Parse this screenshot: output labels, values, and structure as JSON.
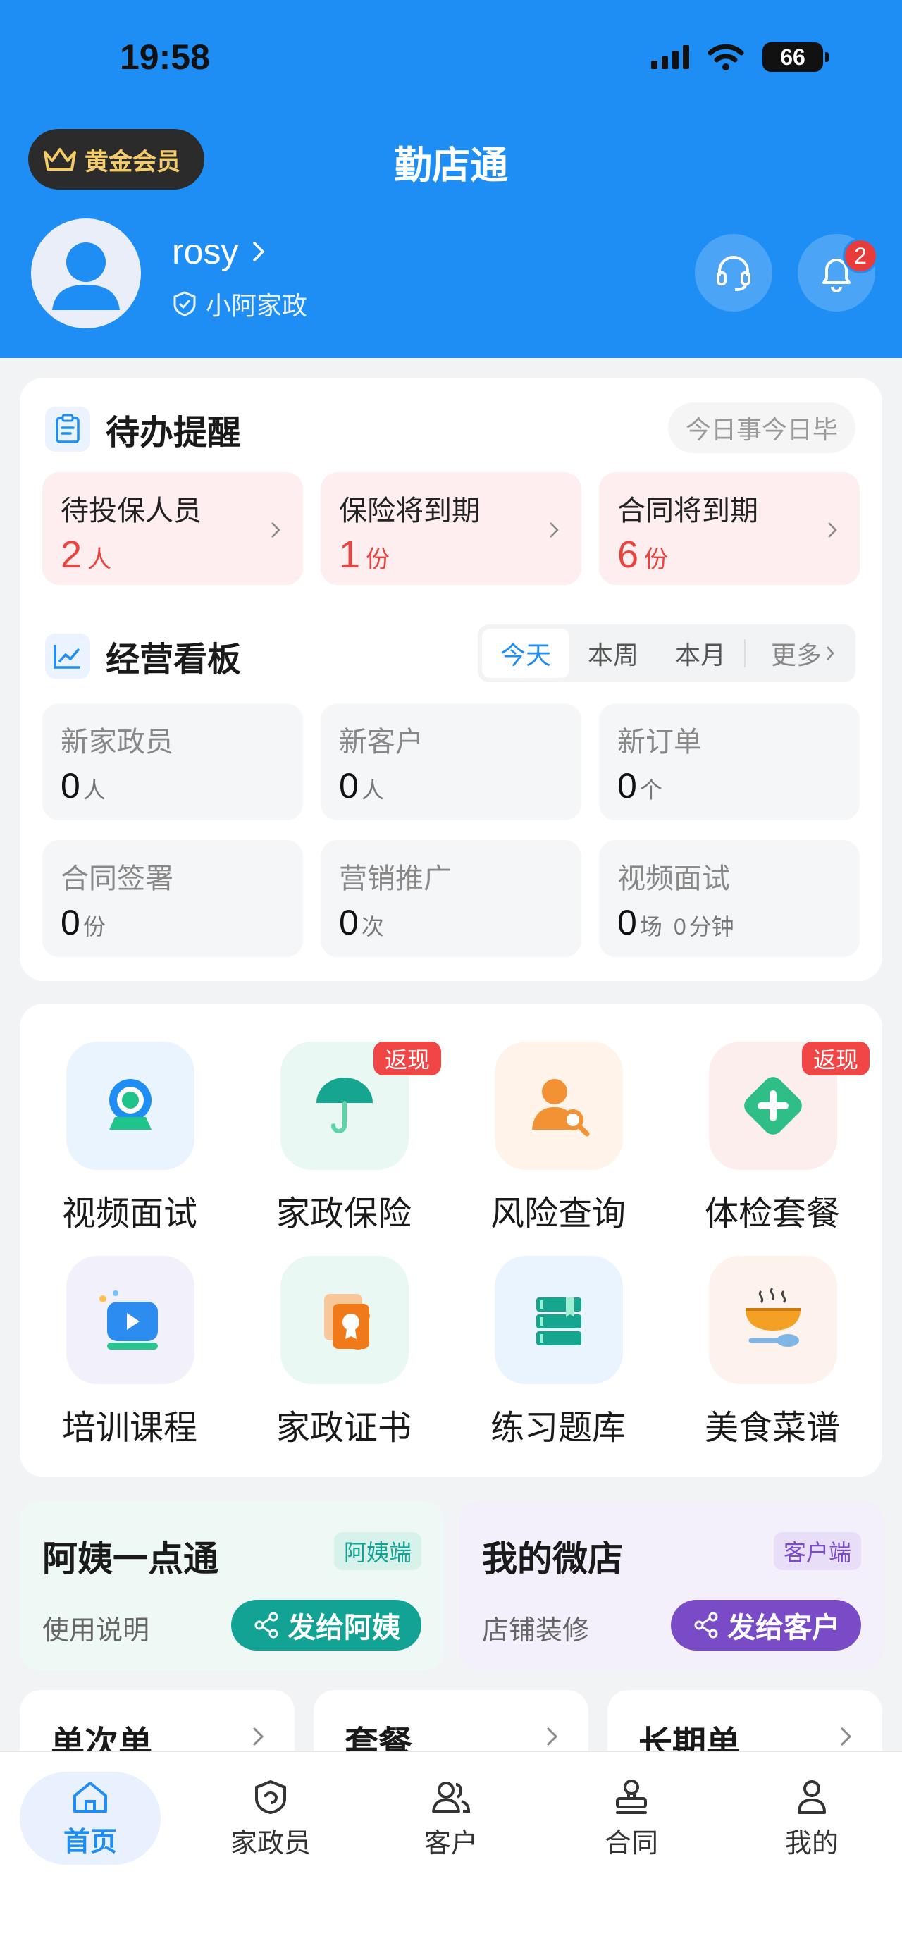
{
  "status_bar": {
    "time": "19:58",
    "battery": "66"
  },
  "header": {
    "vip_label": "黄金会员",
    "title": "勤店通",
    "user_name": "rosy",
    "shop_name": "小阿家政",
    "notification_count": "2"
  },
  "todo": {
    "title": "待办提醒",
    "motto": "今日事今日毕",
    "items": [
      {
        "label": "待投保人员",
        "value": "2",
        "unit": "人"
      },
      {
        "label": "保险将到期",
        "value": "1",
        "unit": "份"
      },
      {
        "label": "合同将到期",
        "value": "6",
        "unit": "份"
      }
    ]
  },
  "board": {
    "title": "经营看板",
    "tabs": [
      "今天",
      "本周",
      "本月"
    ],
    "more": "更多",
    "active_tab": "今天",
    "stats": [
      {
        "label": "新家政员",
        "value": "0",
        "unit": "人"
      },
      {
        "label": "新客户",
        "value": "0",
        "unit": "人"
      },
      {
        "label": "新订单",
        "value": "0",
        "unit": "个"
      },
      {
        "label": "合同签署",
        "value": "0",
        "unit": "份"
      },
      {
        "label": "营销推广",
        "value": "0",
        "unit": "次"
      },
      {
        "label": "视频面试",
        "value": "0",
        "unit": "场",
        "value2": "0",
        "unit2": "分钟"
      }
    ]
  },
  "services": {
    "cashback_label": "返现",
    "items": [
      {
        "label": "视频面试",
        "icon": "video-camera-icon"
      },
      {
        "label": "家政保险",
        "icon": "umbrella-icon"
      },
      {
        "label": "风险查询",
        "icon": "person-search-icon"
      },
      {
        "label": "体检套餐",
        "icon": "medical-cross-icon"
      },
      {
        "label": "培训课程",
        "icon": "video-play-icon"
      },
      {
        "label": "家政证书",
        "icon": "certificate-icon"
      },
      {
        "label": "练习题库",
        "icon": "book-stack-icon"
      },
      {
        "label": "美食菜谱",
        "icon": "bowl-icon"
      }
    ]
  },
  "promo": {
    "left": {
      "title": "阿姨一点通",
      "tag": "阿姨端",
      "link": "使用说明",
      "button": "发给阿姨",
      "color": "#12a394"
    },
    "right": {
      "title": "我的微店",
      "tag": "客户端",
      "link": "店铺装修",
      "button": "发给客户",
      "color": "#7a4bc6"
    }
  },
  "order_types": [
    "单次单",
    "套餐",
    "长期单"
  ],
  "tabbar": {
    "items": [
      {
        "label": "首页",
        "icon": "home-icon"
      },
      {
        "label": "家政员",
        "icon": "housekeeper-icon"
      },
      {
        "label": "客户",
        "icon": "customers-icon"
      },
      {
        "label": "合同",
        "icon": "stamp-icon"
      },
      {
        "label": "我的",
        "icon": "profile-icon"
      }
    ],
    "active": "首页"
  },
  "colors": {
    "primary": "#1e8ef4",
    "alert": "#e8433d",
    "teal": "#12a394",
    "purple": "#7a4bc6"
  }
}
